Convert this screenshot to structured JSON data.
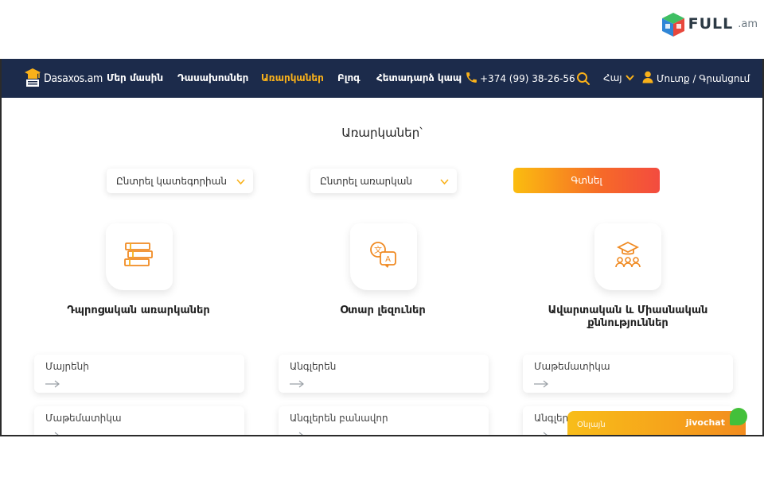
{
  "watermark": {
    "word": "FULL",
    "domain": ".am"
  },
  "nav": {
    "logo": "Dasaxos.am",
    "items": [
      {
        "label": "Մեր մասին",
        "active": false
      },
      {
        "label": "Դասախոսներ",
        "active": false
      },
      {
        "label": "Առարկաներ",
        "active": true
      },
      {
        "label": "Բլոգ",
        "active": false
      },
      {
        "label": "Հետադարձ կապ",
        "active": false
      }
    ],
    "phone": "+374 (99) 38-26-56",
    "lang": "Հայ",
    "login": "Մուտք / Գրանցում"
  },
  "main": {
    "title": "Առարկաներ՝",
    "category_select": "Ընտրել կատեգորիան",
    "subject_select": "Ընտրել առարկան",
    "find_button": "Գտնել",
    "categories": [
      {
        "title": "Դպրոցական առարկաներ",
        "icon": "books-icon",
        "subjects": [
          "Մայրենի",
          "Մաթեմատիկա"
        ]
      },
      {
        "title": "Օտար լեզուներ",
        "icon": "language-icon",
        "subjects": [
          "Անգլերեն",
          "Անգլերեն բանավոր"
        ]
      },
      {
        "title": "Ավարտական և Միասնական քննություններ",
        "icon": "graduation-icon",
        "subjects": [
          "Մաթեմատիկա",
          "Անգլերեն"
        ]
      }
    ]
  },
  "chat": {
    "label": "Օնլայն",
    "brand": "jivochat"
  },
  "colors": {
    "nav_bg": "#1c2b4b",
    "accent": "#f9b11a",
    "button_from": "#fbbd0f",
    "button_to": "#f34b3f"
  }
}
